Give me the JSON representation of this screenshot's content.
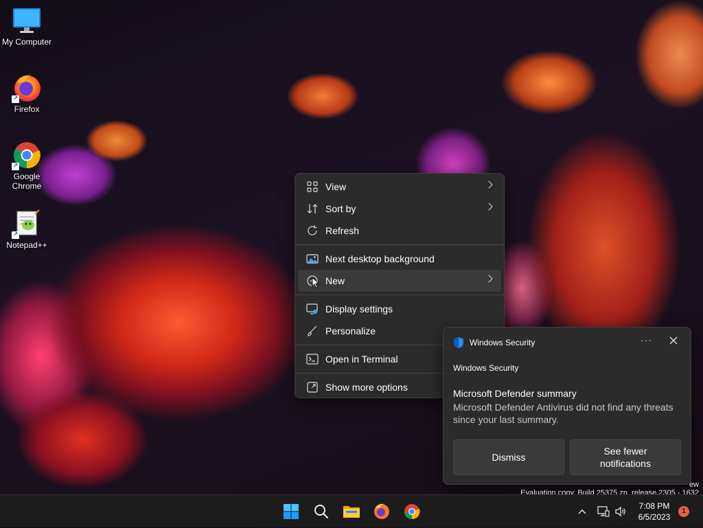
{
  "desktop": {
    "icons": [
      {
        "label": "My Computer",
        "icon": "monitor-icon"
      },
      {
        "label": "Firefox",
        "icon": "firefox-icon"
      },
      {
        "label": "Google Chrome",
        "icon": "chrome-icon"
      },
      {
        "label": "Notepad++",
        "icon": "notepadpp-icon"
      }
    ],
    "watermark": {
      "line1": "ew",
      "line2": "Evaluation copy. Build 25375.zn_release.2305 - 1632"
    }
  },
  "context_menu": {
    "items": [
      {
        "label": "View",
        "icon": "grid-icon",
        "submenu": true
      },
      {
        "label": "Sort by",
        "icon": "sort-icon",
        "submenu": true
      },
      {
        "label": "Refresh",
        "icon": "refresh-icon",
        "submenu": false
      },
      {
        "label": "Next desktop background",
        "icon": "wallpaper-icon",
        "submenu": false
      },
      {
        "label": "New",
        "icon": "add-circle-icon",
        "submenu": true
      },
      {
        "label": "Display settings",
        "icon": "display-settings-icon",
        "submenu": false
      },
      {
        "label": "Personalize",
        "icon": "brush-icon",
        "submenu": false
      },
      {
        "label": "Open in Terminal",
        "icon": "terminal-icon",
        "submenu": false
      },
      {
        "label": "Show more options",
        "icon": "expand-icon",
        "submenu": false
      }
    ]
  },
  "notification": {
    "app_name": "Windows Security",
    "app_label": "Windows Security",
    "more_glyph": "···",
    "title": "Microsoft Defender summary",
    "body": "Microsoft Defender Antivirus did not find any threats since your last summary.",
    "dismiss_label": "Dismiss",
    "fewer_label": "See fewer notifications"
  },
  "taskbar": {
    "time": "7:08 PM",
    "date": "6/5/2023",
    "notification_count": "1"
  },
  "colors": {
    "menu_bg": "#2b2b2b",
    "taskbar_bg": "#1c1c1c",
    "accent_blue": "#1e90ff",
    "badge": "#e8604a"
  }
}
